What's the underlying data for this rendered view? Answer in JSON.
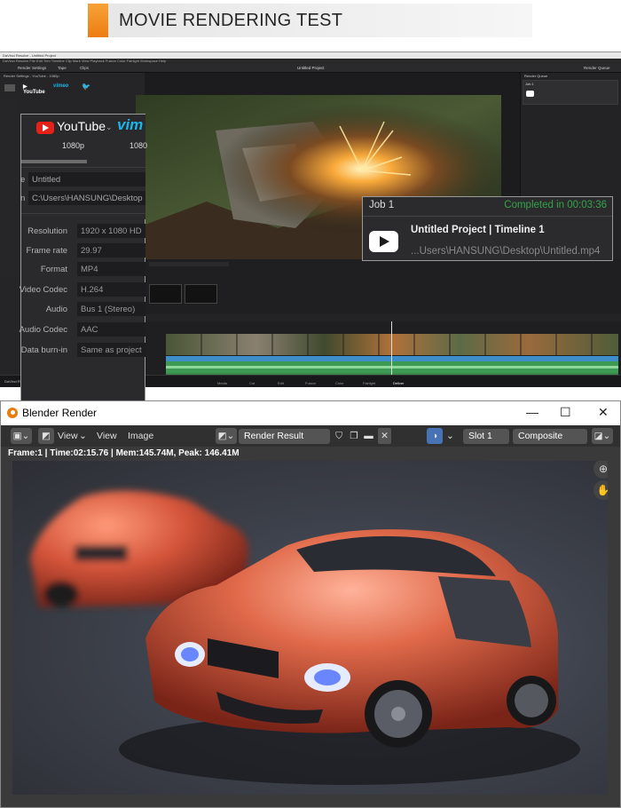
{
  "banner": {
    "title": "MOVIE RENDERING TEST"
  },
  "resolve": {
    "window_title": "DaVinci Resolve - Untitled Project",
    "menu": "DaVinci Resolve  File  Edit  Trim  Timeline  Clip  Mark  View  Playback  Fusion  Color  Fairlight  Workspace  Help",
    "toolbar": {
      "render_settings": "Render Settings",
      "tape": "Tape",
      "clips": "Clips",
      "project": "Untitled Project",
      "render_queue": "Render Queue",
      "timeline": "Timeline 1"
    },
    "left_panel_title": "Render Settings - YouTube - 1080p",
    "popup": {
      "platform": "YouTube",
      "vimeo": "vim",
      "resolution_preset": "1080p",
      "resolution_preset_2": "1080",
      "name_label": "e",
      "name_value": "Untitled",
      "location_label": "n",
      "location_value": "C:\\Users\\HANSUNG\\Desktop",
      "fields": [
        {
          "label": "Resolution",
          "value": "1920 x 1080 HD"
        },
        {
          "label": "Frame rate",
          "value": "29.97"
        },
        {
          "label": "Format",
          "value": "MP4"
        },
        {
          "label": "Video Codec",
          "value": "H.264"
        },
        {
          "label": "Audio",
          "value": "Bus 1 (Stereo)"
        },
        {
          "label": "Audio Codec",
          "value": "AAC"
        },
        {
          "label": "Data burn-in",
          "value": "Same as project"
        }
      ]
    },
    "job": {
      "title": "Job 1",
      "status": "Completed in 00:03:36",
      "project": "Untitled Project | Timeline 1",
      "path": "...Users\\HANSUNG\\Desktop\\Untitled.mp4"
    },
    "queue": {
      "title": "Render Queue",
      "job": "Job 1"
    },
    "add_to_queue": "Add to Render Queue",
    "bottom_tabs": [
      "Media",
      "Cut",
      "Edit",
      "Fusion",
      "Color",
      "Fairlight",
      "Deliver"
    ],
    "app_version": "DaVinci Resolve 17"
  },
  "blender": {
    "window_title": "Blender Render",
    "menu_view": "View",
    "menu_view2": "View",
    "menu_image": "Image",
    "image_name": "Render Result",
    "slot": "Slot 1",
    "pass": "Composite",
    "info": "Frame:1 | Time:02:15.76 | Mem:145.74M, Peak: 146.41M",
    "window_controls": {
      "minimize": "—",
      "maximize": "☐",
      "close": "✕"
    }
  },
  "colors": {
    "accent_orange": "#ed7d12",
    "completed_green": "#35a34a",
    "youtube_red": "#e62117"
  }
}
